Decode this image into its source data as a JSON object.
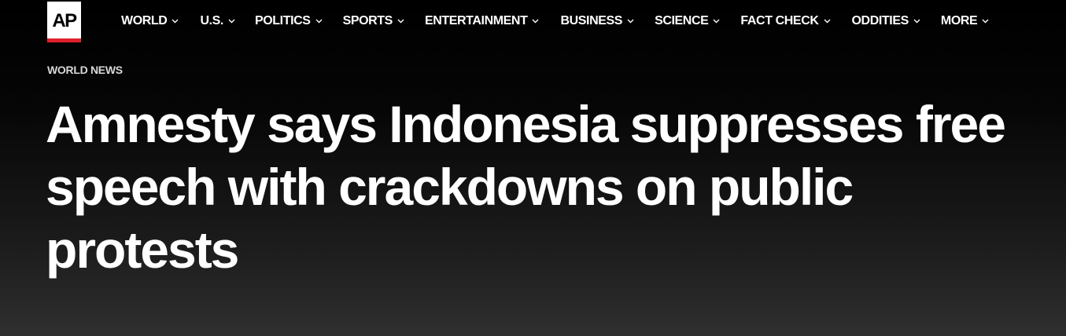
{
  "logo": {
    "text": "AP",
    "accent_color": "#e0202a"
  },
  "nav": {
    "items": [
      {
        "label": "WORLD",
        "icon": "chevron-down-icon"
      },
      {
        "label": "U.S.",
        "icon": "chevron-down-icon"
      },
      {
        "label": "POLITICS",
        "icon": "chevron-down-icon"
      },
      {
        "label": "SPORTS",
        "icon": "chevron-down-icon"
      },
      {
        "label": "ENTERTAINMENT",
        "icon": "chevron-down-icon"
      },
      {
        "label": "BUSINESS",
        "icon": "chevron-down-icon"
      },
      {
        "label": "SCIENCE",
        "icon": "chevron-down-icon"
      },
      {
        "label": "FACT CHECK",
        "icon": "chevron-down-icon"
      },
      {
        "label": "ODDITIES",
        "icon": "chevron-down-icon"
      },
      {
        "label": "MORE",
        "icon": "chevron-down-icon"
      }
    ]
  },
  "article": {
    "section": "WORLD NEWS",
    "headline": "Amnesty says Indonesia suppresses free speech with crackdowns on public protests"
  },
  "colors": {
    "background_top": "#000000",
    "background_bottom": "#2f2f2f",
    "text": "#ffffff"
  }
}
